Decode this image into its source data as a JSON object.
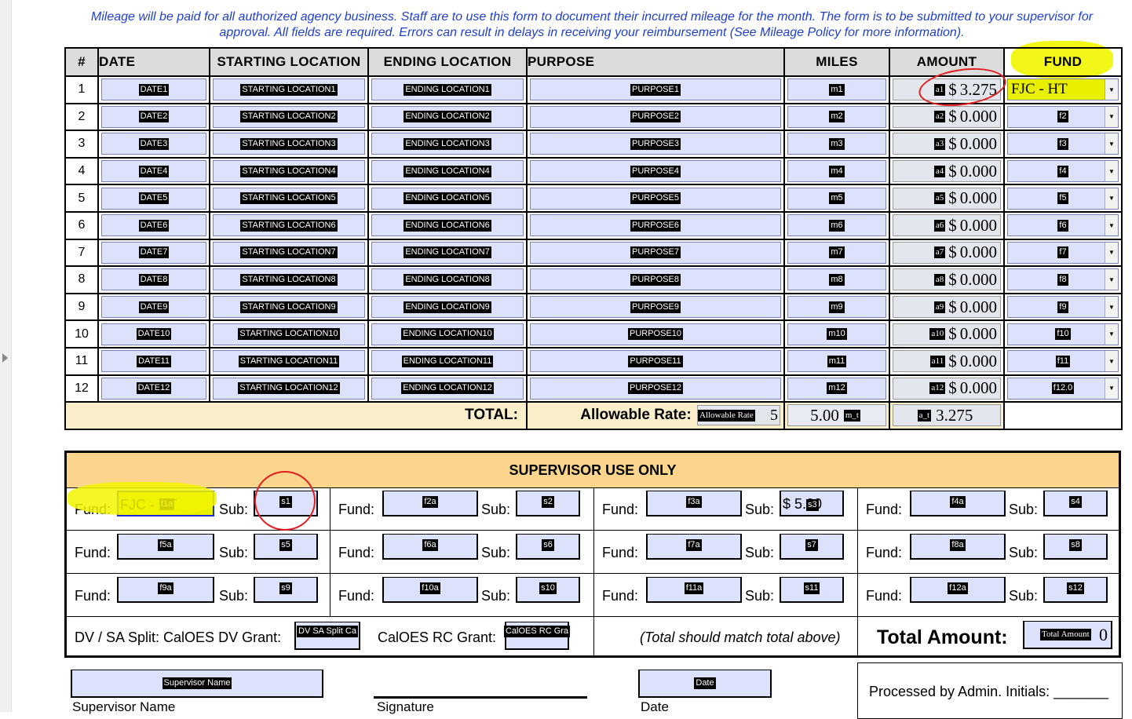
{
  "intro": "Mileage will be paid for all authorized agency business. Staff are to use this form to document their incurred mileage for the month. The form is to be submitted to your supervisor for approval. All fields are required. Errors can result in delays in receiving your reimbursement (See Mileage Policy for more information).",
  "headers": {
    "num": "#",
    "date": "DATE",
    "start": "STARTING LOCATION",
    "end": "ENDING LOCATION",
    "purpose": "PURPOSE",
    "miles": "MILES",
    "amount": "AMOUNT",
    "fund": "FUND"
  },
  "rows": [
    {
      "n": "1",
      "date": "DATE1",
      "start": "STARTING LOCATION1",
      "end": "ENDING LOCATION1",
      "purpose": "PURPOSE1",
      "miles": "m1",
      "amt_tag": "a1",
      "amt": "3.275",
      "fund": "FJC - HT"
    },
    {
      "n": "2",
      "date": "DATE2",
      "start": "STARTING LOCATION2",
      "end": "ENDING LOCATION2",
      "purpose": "PURPOSE2",
      "miles": "m2",
      "amt_tag": "a2",
      "amt": "0.000",
      "fund": "f2"
    },
    {
      "n": "3",
      "date": "DATE3",
      "start": "STARTING LOCATION3",
      "end": "ENDING LOCATION3",
      "purpose": "PURPOSE3",
      "miles": "m3",
      "amt_tag": "a3",
      "amt": "0.000",
      "fund": "f3"
    },
    {
      "n": "4",
      "date": "DATE4",
      "start": "STARTING LOCATION4",
      "end": "ENDING LOCATION4",
      "purpose": "PURPOSE4",
      "miles": "m4",
      "amt_tag": "a4",
      "amt": "0.000",
      "fund": "f4"
    },
    {
      "n": "5",
      "date": "DATE5",
      "start": "STARTING LOCATION5",
      "end": "ENDING LOCATION5",
      "purpose": "PURPOSE5",
      "miles": "m5",
      "amt_tag": "a5",
      "amt": "0.000",
      "fund": "f5"
    },
    {
      "n": "6",
      "date": "DATE6",
      "start": "STARTING LOCATION6",
      "end": "ENDING LOCATION6",
      "purpose": "PURPOSE6",
      "miles": "m6",
      "amt_tag": "a6",
      "amt": "0.000",
      "fund": "f6"
    },
    {
      "n": "7",
      "date": "DATE7",
      "start": "STARTING LOCATION7",
      "end": "ENDING LOCATION7",
      "purpose": "PURPOSE7",
      "miles": "m7",
      "amt_tag": "a7",
      "amt": "0.000",
      "fund": "f7"
    },
    {
      "n": "8",
      "date": "DATE8",
      "start": "STARTING LOCATION8",
      "end": "ENDING LOCATION8",
      "purpose": "PURPOSE8",
      "miles": "m8",
      "amt_tag": "a8",
      "amt": "0.000",
      "fund": "f8"
    },
    {
      "n": "9",
      "date": "DATE9",
      "start": "STARTING LOCATION9",
      "end": "ENDING LOCATION9",
      "purpose": "PURPOSE9",
      "miles": "m9",
      "amt_tag": "a9",
      "amt": "0.000",
      "fund": "f9"
    },
    {
      "n": "10",
      "date": "DATE10",
      "start": "STARTING LOCATION10",
      "end": "ENDING LOCATION10",
      "purpose": "PURPOSE10",
      "miles": "m10",
      "amt_tag": "a10",
      "amt": "0.000",
      "fund": "f10"
    },
    {
      "n": "11",
      "date": "DATE11",
      "start": "STARTING LOCATION11",
      "end": "ENDING LOCATION11",
      "purpose": "PURPOSE11",
      "miles": "m11",
      "amt_tag": "a11",
      "amt": "0.000",
      "fund": "f11"
    },
    {
      "n": "12",
      "date": "DATE12",
      "start": "STARTING LOCATION12",
      "end": "ENDING LOCATION12",
      "purpose": "PURPOSE12",
      "miles": "m12",
      "amt_tag": "a12",
      "amt": "0.000",
      "fund": "f12.0"
    }
  ],
  "totals": {
    "total_label": "TOTAL:",
    "rate_label": "Allowable Rate:",
    "rate_tag": "Allowable Rate",
    "rate_val": "5",
    "miles_tag": "m_t",
    "miles_val": "5.00",
    "amt_tag": "a_t",
    "amt_val": "3.275"
  },
  "supervisor": {
    "title": "SUPERVISOR USE ONLY",
    "fund_label": "Fund:",
    "sub_label": "Sub:",
    "funds": [
      {
        "fund": "f1a",
        "fund_value": "FJC - HT",
        "sub": "s1",
        "sub_value": ""
      },
      {
        "fund": "f2a",
        "fund_value": "",
        "sub": "s2",
        "sub_value": ""
      },
      {
        "fund": "f3a",
        "fund_value": "",
        "sub": "s3",
        "sub_value": "$ 5.00"
      },
      {
        "fund": "f4a",
        "fund_value": "",
        "sub": "s4",
        "sub_value": ""
      },
      {
        "fund": "f5a",
        "fund_value": "",
        "sub": "s5",
        "sub_value": ""
      },
      {
        "fund": "f6a",
        "fund_value": "",
        "sub": "s6",
        "sub_value": ""
      },
      {
        "fund": "f7a",
        "fund_value": "",
        "sub": "s7",
        "sub_value": ""
      },
      {
        "fund": "f8a",
        "fund_value": "",
        "sub": "s8",
        "sub_value": ""
      },
      {
        "fund": "f9a",
        "fund_value": "",
        "sub": "s9",
        "sub_value": ""
      },
      {
        "fund": "f10a",
        "fund_value": "",
        "sub": "s10",
        "sub_value": ""
      },
      {
        "fund": "f11a",
        "fund_value": "",
        "sub": "s11",
        "sub_value": ""
      },
      {
        "fund": "f12a",
        "fund_value": "",
        "sub": "s12",
        "sub_value": ""
      }
    ],
    "split_label": "DV / SA Split: CalOES DV Grant:",
    "split_tag": "DV SA Split Ca",
    "rc_label": "CalOES RC Grant:",
    "rc_tag": "CalOES RC Gra",
    "note": "(Total should match total above)",
    "total_amount_label": "Total Amount:",
    "total_amount_tag": "Total Amount",
    "total_amount_val": "0"
  },
  "footer": {
    "sup_name_tag": "Supervisor Name",
    "sup_name_caption": "Supervisor Name",
    "signature_caption": "Signature",
    "date_tag": "Date",
    "date_caption": "Date",
    "processed": "Processed by Admin. Initials: _______"
  },
  "colors": {
    "field": "#dde2fc",
    "header": "#dcdcdc",
    "total_row": "#fbeecb",
    "supervisor_head": "#fbd58c",
    "intro_text": "#1f3fd1",
    "highlight": "#f2f500",
    "annotation": "#e41e1e"
  }
}
